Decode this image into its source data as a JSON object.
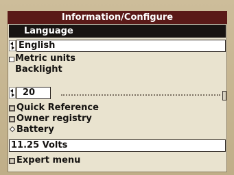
{
  "window": {
    "title": "Information/Configure"
  },
  "language": {
    "section_label": "Language",
    "selected_value": "English"
  },
  "metric_units": {
    "label": "Metric units",
    "checked": false
  },
  "backlight": {
    "label": "Backlight",
    "value": "20",
    "level_fraction": 1.0
  },
  "menu": {
    "quick_reference": "Quick Reference",
    "owner_registry": "Owner registry",
    "battery": "Battery",
    "expert_menu": "Expert menu"
  },
  "battery": {
    "reading": "11.25 Volts"
  },
  "colors": {
    "title_bar": "#5a1a18",
    "selected_row": "#181412",
    "screen_bg": "#e9e3cf"
  },
  "icons": {
    "selector": "left-right-arrow-icon",
    "checkbox": "checkbox-icon",
    "expand": "expand-box-icon",
    "radio": "diamond-icon"
  }
}
